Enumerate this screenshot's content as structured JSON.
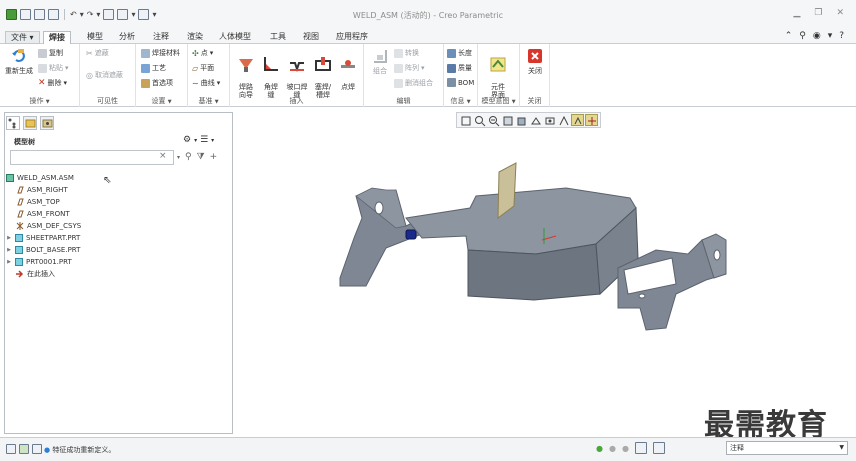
{
  "window": {
    "title": "WELD_ASM (活动的) - Creo Parametric"
  },
  "tabs": [
    "文件",
    "焊接",
    "模型",
    "分析",
    "注释",
    "渲染",
    "人体模型",
    "工具",
    "视图",
    "应用程序"
  ],
  "ribbon": {
    "operations": {
      "regenerate": "重新生成",
      "copy": "复制",
      "paste": "粘贴",
      "delete": "删除",
      "label": "操作"
    },
    "visibility": {
      "prep": "遮蔽",
      "unprep": "取消遮蔽",
      "label": "可见性"
    },
    "settings": {
      "weld_material": "焊接材料",
      "process": "工艺",
      "prefs": "首选项",
      "label": "设置"
    },
    "datum": {
      "point": "点",
      "plane": "平面",
      "curve": "曲线",
      "label": "基准"
    },
    "insert": {
      "path_guide": "焊路\n向导",
      "fillet": "角焊\n缝",
      "groove": "坡口焊\n缝",
      "plug": "塞焊/\n槽焊",
      "spot": "点焊",
      "label": "插入"
    },
    "edit": {
      "combine": "组合",
      "convert": "转换",
      "pattern": "阵列",
      "uncombine": "删消组合",
      "label": "编辑"
    },
    "info": {
      "length": "长度",
      "mass": "质量",
      "bom": "BOM",
      "label": "信息"
    },
    "model_intent": {
      "element_ui": "元件\n界面",
      "label": "模型意图"
    },
    "close": {
      "close": "关闭",
      "label": "关闭"
    }
  },
  "model_tree": {
    "header": "模型树",
    "search_placeholder": "",
    "items": [
      {
        "label": "WELD_ASM.ASM",
        "type": "assembly",
        "expandable": false
      },
      {
        "label": "ASM_RIGHT",
        "type": "plane",
        "expandable": false
      },
      {
        "label": "ASM_TOP",
        "type": "plane",
        "expandable": false
      },
      {
        "label": "ASM_FRONT",
        "type": "plane",
        "expandable": false
      },
      {
        "label": "ASM_DEF_CSYS",
        "type": "csys",
        "expandable": false
      },
      {
        "label": "SHEETPART.PRT",
        "type": "part",
        "expandable": true
      },
      {
        "label": "BOLT_BASE.PRT",
        "type": "part",
        "expandable": true
      },
      {
        "label": "PRT0001.PRT",
        "type": "part",
        "expandable": true
      },
      {
        "label": "在此插入",
        "type": "insert",
        "expandable": false
      }
    ]
  },
  "status": {
    "message": "特征成功重新定义。"
  },
  "filter": {
    "value": "注释"
  },
  "watermark": {
    "text": "最需教育"
  },
  "colors": {
    "accent": "#1f6fbf",
    "model": "#7f8794",
    "model_dark": "#5b636e",
    "highlight_bolt": "#1a2a8c"
  }
}
